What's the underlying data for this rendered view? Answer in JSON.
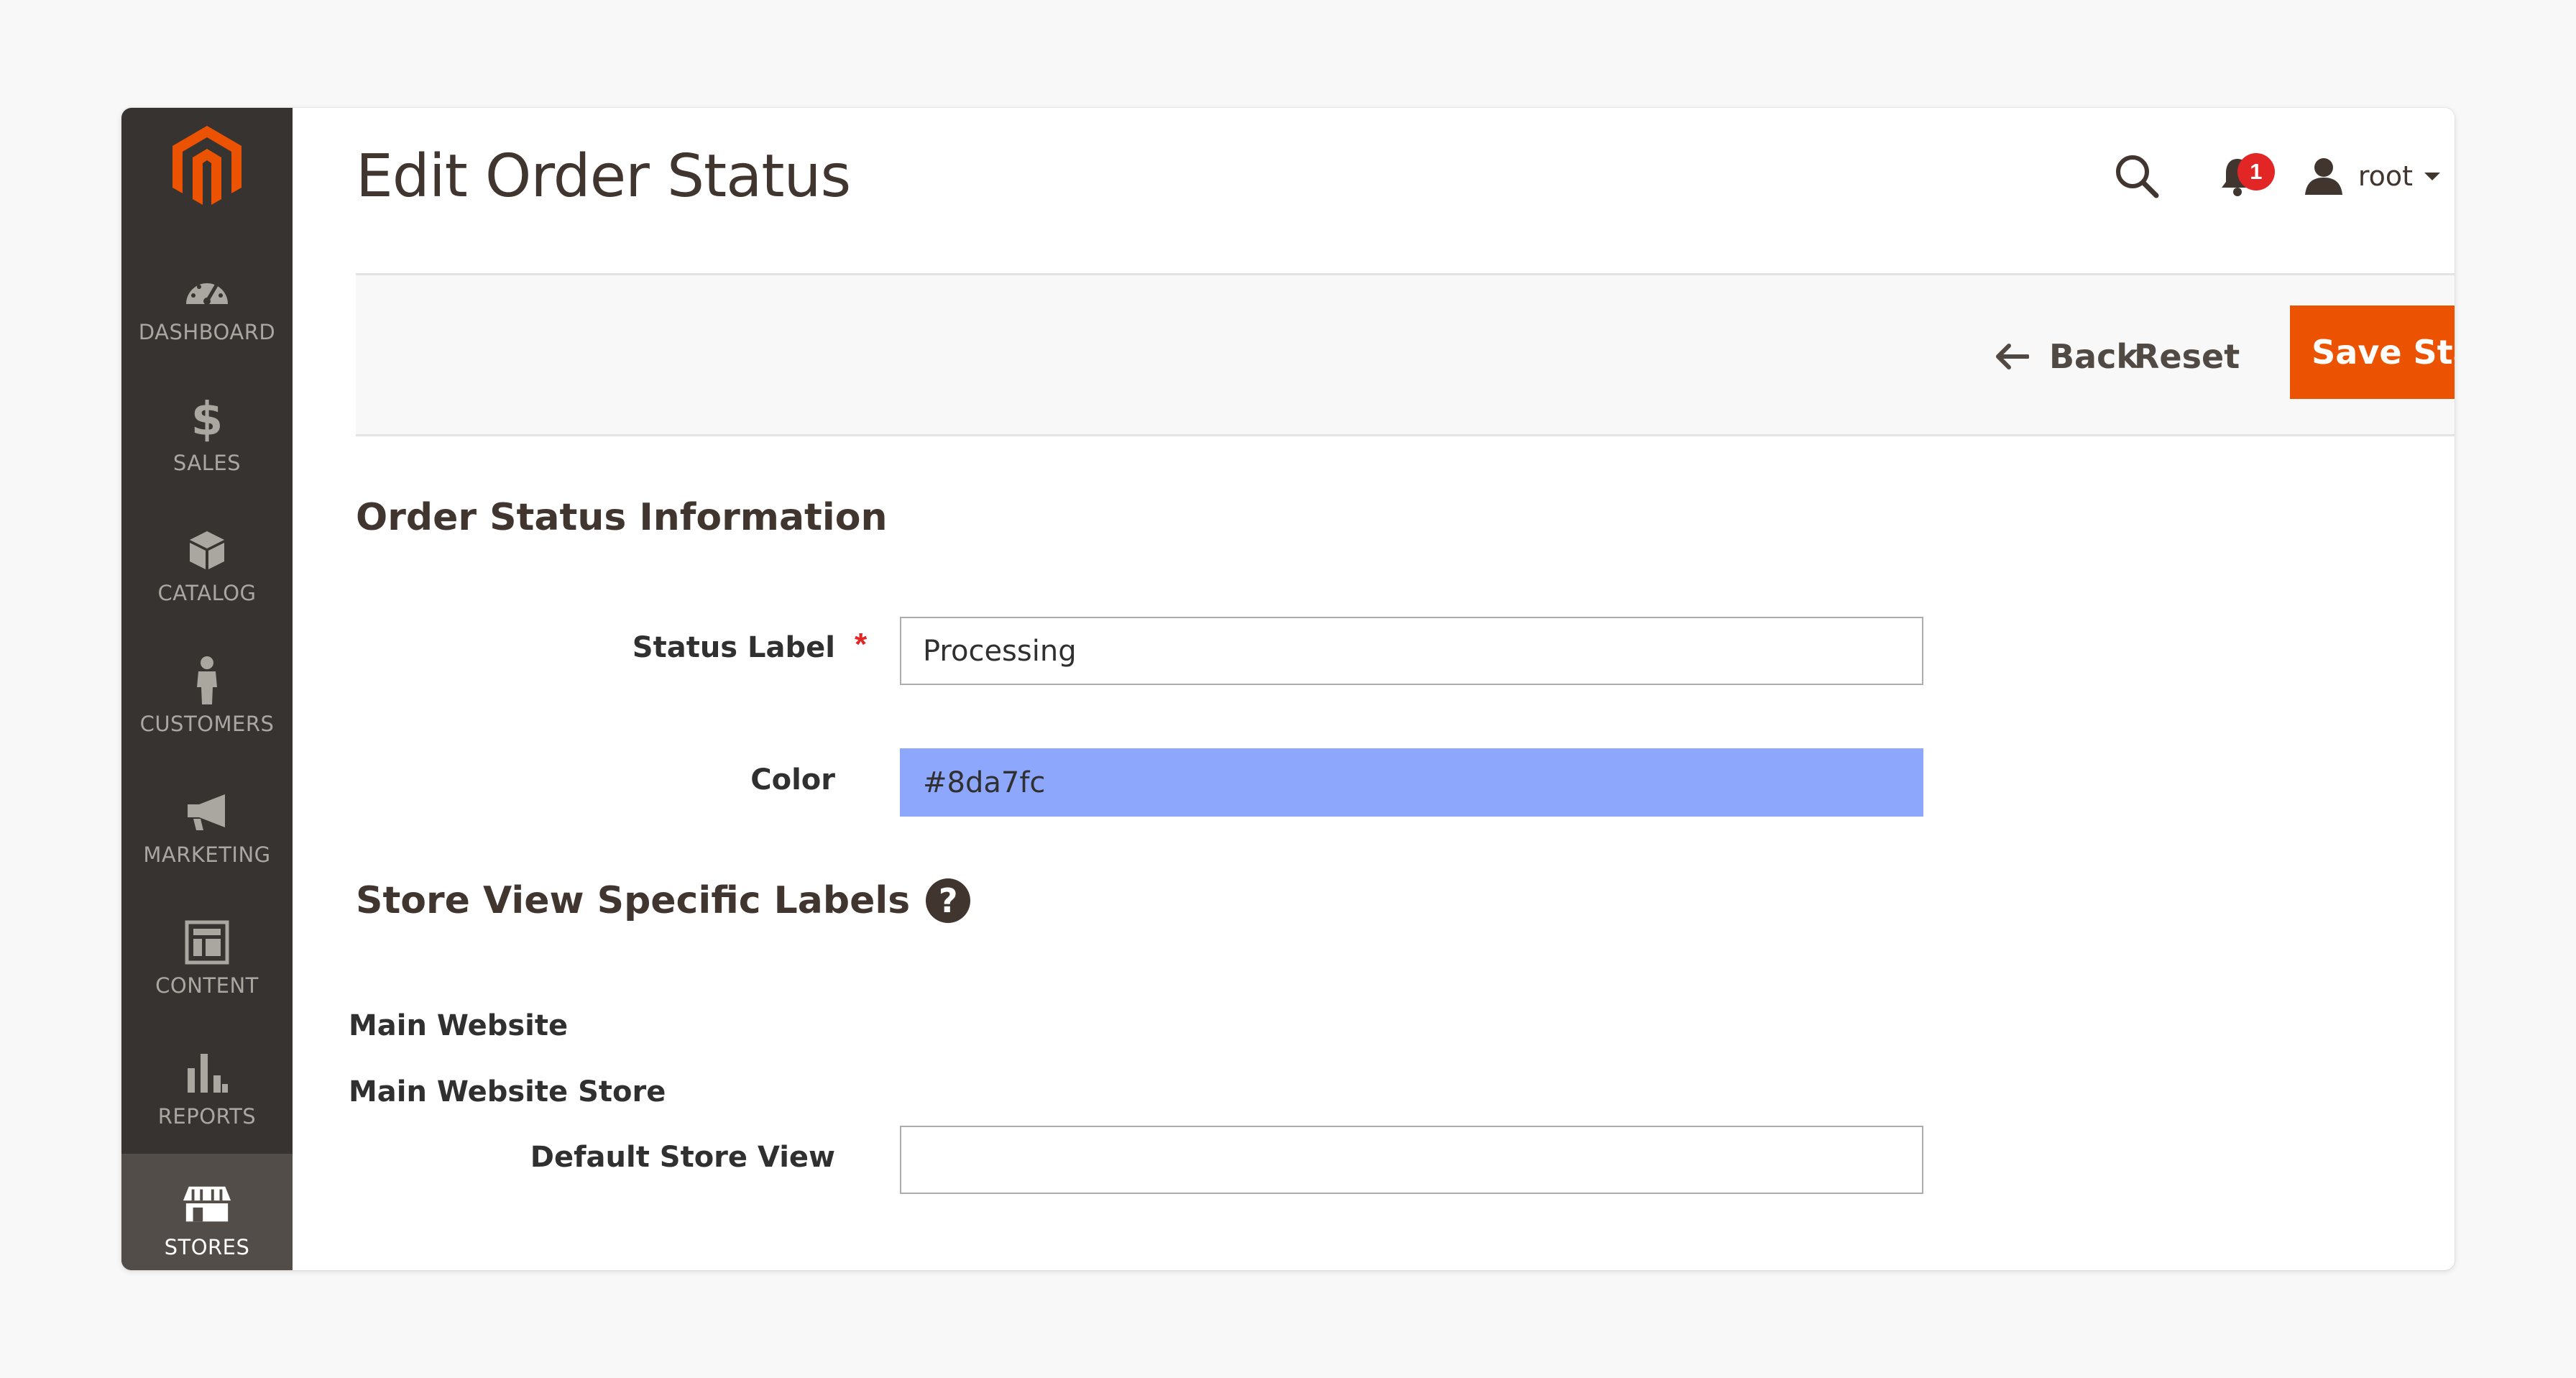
{
  "sidebar": {
    "logo": "magento-logo",
    "items": [
      {
        "label": "DASHBOARD",
        "icon": "dashboard-icon",
        "active": false
      },
      {
        "label": "SALES",
        "icon": "dollar-icon",
        "active": false
      },
      {
        "label": "CATALOG",
        "icon": "box-icon",
        "active": false
      },
      {
        "label": "CUSTOMERS",
        "icon": "person-icon",
        "active": false
      },
      {
        "label": "MARKETING",
        "icon": "megaphone-icon",
        "active": false
      },
      {
        "label": "CONTENT",
        "icon": "layout-icon",
        "active": false
      },
      {
        "label": "REPORTS",
        "icon": "bar-chart-icon",
        "active": false
      },
      {
        "label": "STORES",
        "icon": "store-icon",
        "active": true
      }
    ],
    "colors": {
      "background": "#373330",
      "active": "#524d49",
      "logo": "#eb5202"
    }
  },
  "header": {
    "title": "Edit Order Status",
    "notifications_count": "1",
    "username": "root"
  },
  "actions": {
    "back_label": "Back",
    "reset_label": "Reset",
    "save_label": "Save Status",
    "save_color": "#eb5202"
  },
  "form": {
    "section_title": "Order Status Information",
    "status_label": {
      "label": "Status Label",
      "required_mark": "*",
      "value": "Processing"
    },
    "color": {
      "label": "Color",
      "value": "#8da7fc"
    }
  },
  "store_labels": {
    "section_title": "Store View Specific Labels",
    "help_glyph": "?",
    "website": "Main Website",
    "store": "Main Website Store",
    "store_view": {
      "label": "Default Store View",
      "value": ""
    }
  }
}
